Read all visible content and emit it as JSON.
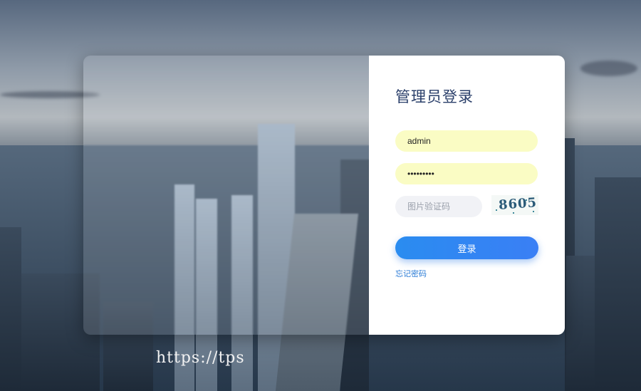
{
  "login": {
    "title": "管理员登录",
    "username_value": "admin",
    "password_value": "•••••••••",
    "captcha_placeholder": "图片验证码",
    "captcha_text": "8605",
    "submit_label": "登录",
    "forgot_label": "忘记密码"
  },
  "watermark": {
    "text": "https://tps"
  },
  "colors": {
    "title": "#2a3f6a",
    "filled_input_bg": "#fafcc4",
    "empty_input_bg": "#f1f2f6",
    "button_gradient_start": "#2a8cf0",
    "button_gradient_end": "#3a7ff5",
    "link": "#2b7cd6"
  }
}
